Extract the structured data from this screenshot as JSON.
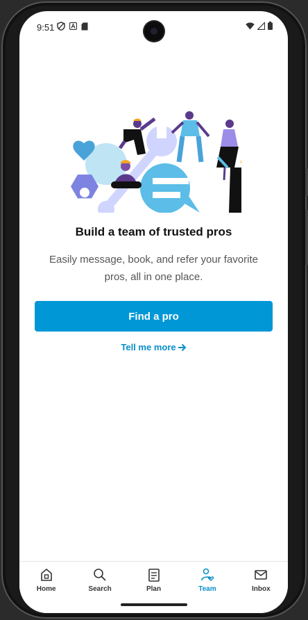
{
  "status": {
    "time": "9:51"
  },
  "onboarding": {
    "headline": "Build a team of trusted pros",
    "subtext": "Easily message, book, and refer your favorite pros, all in one place.",
    "primary_button": "Find a pro",
    "link_label": "Tell me more"
  },
  "tabs": [
    {
      "label": "Home",
      "icon": "home-icon",
      "active": false
    },
    {
      "label": "Search",
      "icon": "search-icon",
      "active": false
    },
    {
      "label": "Plan",
      "icon": "plan-icon",
      "active": false
    },
    {
      "label": "Team",
      "icon": "team-icon",
      "active": true
    },
    {
      "label": "Inbox",
      "icon": "inbox-icon",
      "active": false
    }
  ],
  "colors": {
    "accent": "#0097d6",
    "link": "#0a8fc8"
  }
}
